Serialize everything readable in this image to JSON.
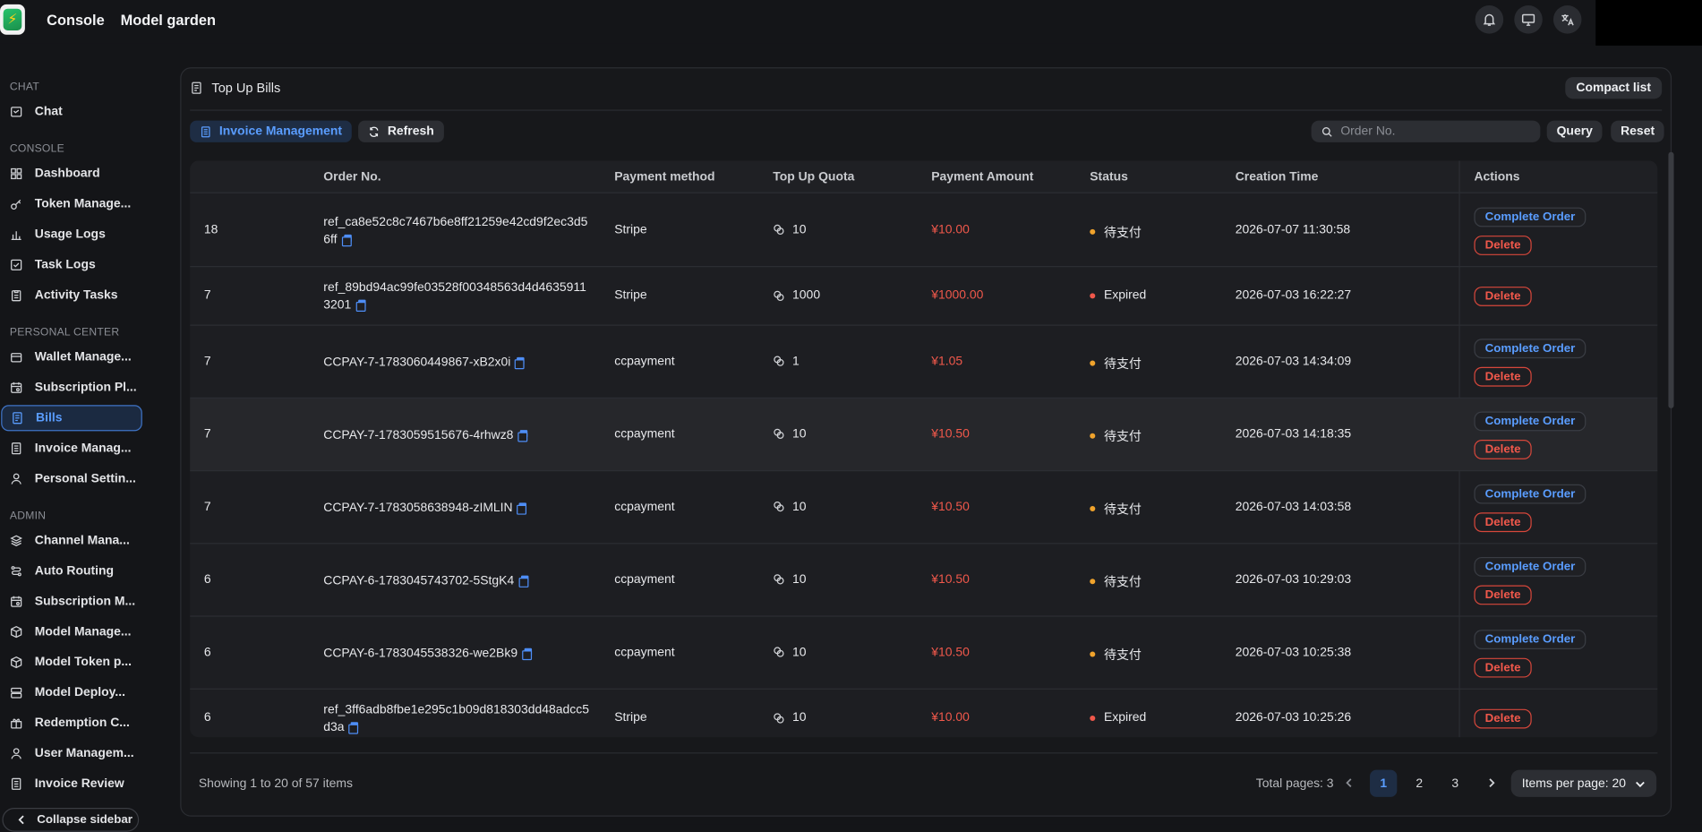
{
  "topbar": {
    "console": "Console",
    "model_garden": "Model garden",
    "icons": [
      "bell-icon",
      "monitor-icon",
      "translate-icon"
    ]
  },
  "sidebar": {
    "sections": [
      {
        "title": "CHAT",
        "items": [
          {
            "label": "Chat",
            "icon": "chat-icon"
          }
        ]
      },
      {
        "title": "CONSOLE",
        "items": [
          {
            "label": "Dashboard",
            "icon": "grid-icon"
          },
          {
            "label": "Token Manage...",
            "icon": "key-icon"
          },
          {
            "label": "Usage Logs",
            "icon": "bar-chart-icon"
          },
          {
            "label": "Task Logs",
            "icon": "checkbox-icon"
          },
          {
            "label": "Activity Tasks",
            "icon": "clipboard-icon"
          }
        ]
      },
      {
        "title": "PERSONAL CENTER",
        "items": [
          {
            "label": "Wallet Manage...",
            "icon": "wallet-icon"
          },
          {
            "label": "Subscription Pl...",
            "icon": "calendar-icon"
          },
          {
            "label": "Bills",
            "icon": "receipt-icon",
            "active": true
          },
          {
            "label": "Invoice Manag...",
            "icon": "document-icon"
          },
          {
            "label": "Personal Settin...",
            "icon": "user-icon"
          }
        ]
      },
      {
        "title": "ADMIN",
        "items": [
          {
            "label": "Channel Mana...",
            "icon": "layers-icon"
          },
          {
            "label": "Auto Routing",
            "icon": "route-icon"
          },
          {
            "label": "Subscription M...",
            "icon": "calendar-icon"
          },
          {
            "label": "Model Manage...",
            "icon": "cube-icon"
          },
          {
            "label": "Model Token p...",
            "icon": "cube-icon"
          },
          {
            "label": "Model Deploy...",
            "icon": "server-icon"
          },
          {
            "label": "Redemption C...",
            "icon": "gift-icon"
          },
          {
            "label": "User Managem...",
            "icon": "user-icon"
          },
          {
            "label": "Invoice Review",
            "icon": "document-icon"
          }
        ]
      }
    ],
    "collapse_label": "Collapse sidebar"
  },
  "panel": {
    "title": "Top Up Bills",
    "compact_label": "Compact list",
    "invoice_btn": "Invoice Management",
    "refresh_btn": "Refresh",
    "search_placeholder": "Order No.",
    "search_value": "",
    "query_btn": "Query",
    "reset_btn": "Reset"
  },
  "table": {
    "columns": [
      "",
      "Order No.",
      "Payment method",
      "Top Up Quota",
      "Payment Amount",
      "Status",
      "Creation Time",
      "Actions"
    ],
    "complete_label": "Complete Order",
    "delete_label": "Delete",
    "status_colors": {
      "pending": "#f0a32c",
      "expired": "#f0584b"
    },
    "rows": [
      {
        "id": "18",
        "order": "ref_ca8e52c8c7467b6e8ff21259e42cd9f2ec3d56ff",
        "method": "Stripe",
        "quota": "10",
        "amount": "¥10.00",
        "status": "待支付",
        "status_kind": "pending",
        "time": "2026-07-07 11:30:58",
        "can_complete": true
      },
      {
        "id": "7",
        "order": "ref_89bd94ac99fe03528f00348563d4d46359113201",
        "method": "Stripe",
        "quota": "1000",
        "amount": "¥1000.00",
        "status": "Expired",
        "status_kind": "expired",
        "time": "2026-07-03 16:22:27",
        "can_complete": false
      },
      {
        "id": "7",
        "order": "CCPAY-7-1783060449867-xB2x0i",
        "method": "ccpayment",
        "quota": "1",
        "amount": "¥1.05",
        "status": "待支付",
        "status_kind": "pending",
        "time": "2026-07-03 14:34:09",
        "can_complete": true
      },
      {
        "id": "7",
        "order": "CCPAY-7-1783059515676-4rhwz8",
        "method": "ccpayment",
        "quota": "10",
        "amount": "¥10.50",
        "status": "待支付",
        "status_kind": "pending",
        "time": "2026-07-03 14:18:35",
        "can_complete": true,
        "highlighted": true
      },
      {
        "id": "7",
        "order": "CCPAY-7-1783058638948-zIMLIN",
        "method": "ccpayment",
        "quota": "10",
        "amount": "¥10.50",
        "status": "待支付",
        "status_kind": "pending",
        "time": "2026-07-03 14:03:58",
        "can_complete": true
      },
      {
        "id": "6",
        "order": "CCPAY-6-1783045743702-5StgK4",
        "method": "ccpayment",
        "quota": "10",
        "amount": "¥10.50",
        "status": "待支付",
        "status_kind": "pending",
        "time": "2026-07-03 10:29:03",
        "can_complete": true
      },
      {
        "id": "6",
        "order": "CCPAY-6-1783045538326-we2Bk9",
        "method": "ccpayment",
        "quota": "10",
        "amount": "¥10.50",
        "status": "待支付",
        "status_kind": "pending",
        "time": "2026-07-03 10:25:38",
        "can_complete": true
      },
      {
        "id": "6",
        "order": "ref_3ff6adb8fbe1e295c1b09d818303dd48adcc5d3a",
        "method": "Stripe",
        "quota": "10",
        "amount": "¥10.00",
        "status": "Expired",
        "status_kind": "expired",
        "time": "2026-07-03 10:25:26",
        "can_complete": false
      }
    ]
  },
  "pagination": {
    "showing": "Showing 1 to 20 of 57 items",
    "total_pages": "Total pages: 3",
    "pages": [
      "1",
      "2",
      "3"
    ],
    "current_page": "1",
    "per_page": "Items per page: 20"
  }
}
